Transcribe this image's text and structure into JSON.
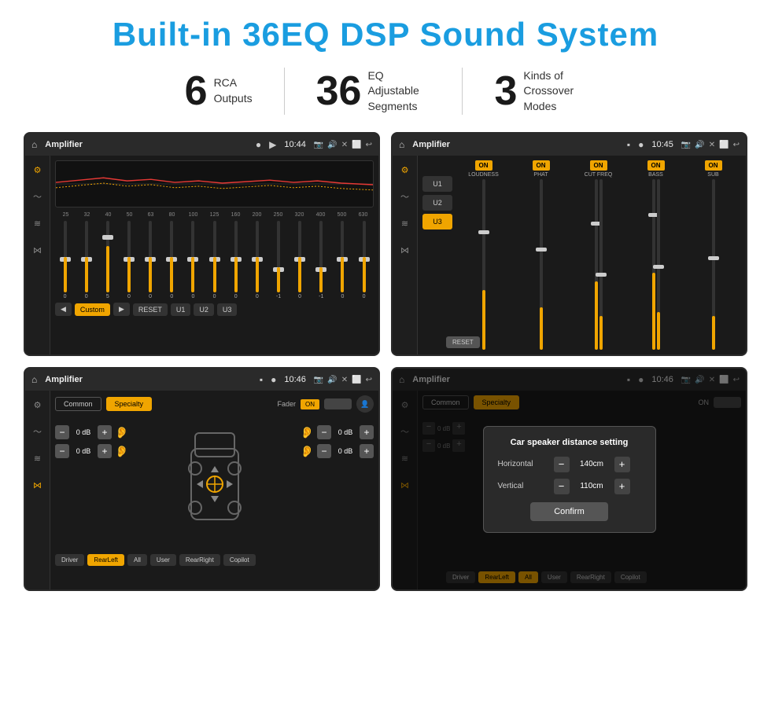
{
  "header": {
    "title": "Built-in 36EQ DSP Sound System"
  },
  "stats": [
    {
      "number": "6",
      "label": "RCA\nOutputs"
    },
    {
      "number": "36",
      "label": "EQ Adjustable\nSegments"
    },
    {
      "number": "3",
      "label": "Kinds of\nCrossover Modes"
    }
  ],
  "screens": [
    {
      "id": "eq-screen",
      "topbar": {
        "title": "Amplifier",
        "time": "10:44"
      },
      "freqs": [
        "25",
        "32",
        "40",
        "50",
        "63",
        "80",
        "100",
        "125",
        "160",
        "200",
        "250",
        "320",
        "400",
        "500",
        "630"
      ],
      "values": [
        "0",
        "0",
        "5",
        "0",
        "0",
        "0",
        "0",
        "0",
        "0",
        "0",
        "-1",
        "0",
        "-1",
        "0",
        "0"
      ],
      "bottom_btns": [
        "Custom",
        "RESET",
        "U1",
        "U2",
        "U3"
      ]
    },
    {
      "id": "crossover-screen",
      "topbar": {
        "title": "Amplifier",
        "time": "10:45"
      },
      "presets": [
        "U1",
        "U2",
        "U3"
      ],
      "channels": [
        "LOUDNESS",
        "PHAT",
        "CUT FREQ",
        "BASS",
        "SUB"
      ],
      "reset_label": "RESET"
    },
    {
      "id": "speaker-screen",
      "topbar": {
        "title": "Amplifier",
        "time": "10:46"
      },
      "tabs": [
        "Common",
        "Specialty"
      ],
      "fader": {
        "label": "Fader",
        "on_label": "ON"
      },
      "speaker_btns": [
        "Driver",
        "RearLeft",
        "All",
        "User",
        "RearRight",
        "Copilot"
      ],
      "vol_rows": [
        {
          "value": "0 dB"
        },
        {
          "value": "0 dB"
        },
        {
          "value": "0 dB"
        },
        {
          "value": "0 dB"
        }
      ]
    },
    {
      "id": "distance-screen",
      "topbar": {
        "title": "Amplifier",
        "time": "10:46"
      },
      "tabs": [
        "Common",
        "Specialty"
      ],
      "dialog": {
        "title": "Car speaker distance setting",
        "rows": [
          {
            "label": "Horizontal",
            "value": "140cm"
          },
          {
            "label": "Vertical",
            "value": "110cm"
          }
        ],
        "confirm_label": "Confirm"
      },
      "speaker_btns": [
        "Driver",
        "RearLeft",
        "All",
        "User",
        "RearRight",
        "Copilot"
      ],
      "vol_rows": [
        {
          "value": "0 dB"
        },
        {
          "value": "0 dB"
        }
      ]
    }
  ]
}
